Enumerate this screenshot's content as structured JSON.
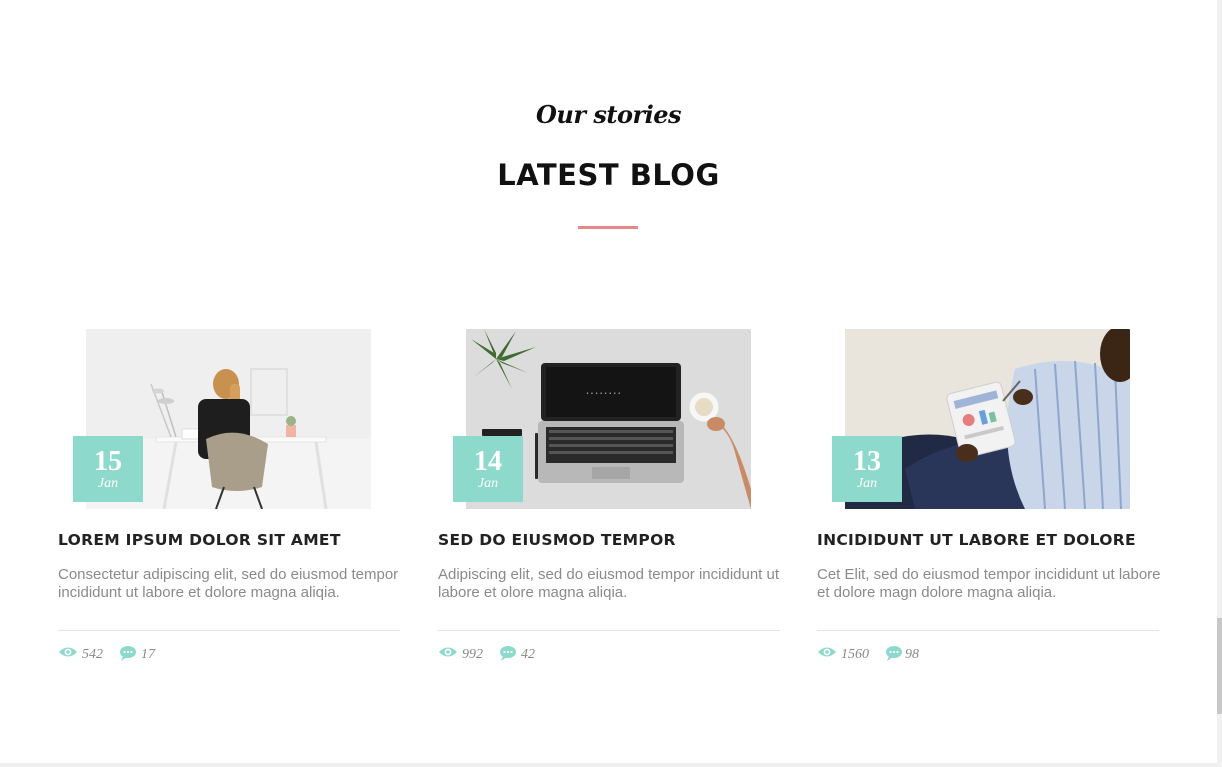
{
  "section": {
    "subtitle": "Our stories",
    "title": "LATEST BLOG"
  },
  "colors": {
    "accent_teal": "#8dd9cc",
    "divider_pink": "#e8878a",
    "text_dark": "#222222",
    "text_muted": "#8a8a8a"
  },
  "posts": [
    {
      "day": "15",
      "month": "Jan",
      "title": "LOREM IPSUM DOLOR SIT AMET",
      "excerpt": "Consectetur adipiscing elit, sed do eiusmod tempor incididunt ut labore et dolore magna aliqia.",
      "views": "542",
      "comments": "17",
      "image": "woman-working-at-desk-photo"
    },
    {
      "day": "14",
      "month": "Jan",
      "title": "SED DO EIUSMOD TEMPOR",
      "excerpt": "Adipiscing elit, sed do eiusmod tempor incididunt ut labore et olore magna aliqia.",
      "views": "992",
      "comments": "42",
      "image": "laptop-on-desk-photo"
    },
    {
      "day": "13",
      "month": "Jan",
      "title": "INCIDIDUNT UT LABORE ET DOLORE",
      "excerpt": "Cet Elit, sed do eiusmod tempor incididunt ut labore et dolore magn dolore magna aliqia.",
      "views": "1560",
      "comments": "98",
      "image": "man-with-tablet-photo"
    }
  ],
  "icons": {
    "views": "eye-icon",
    "comments": "chat-bubble-icon"
  }
}
